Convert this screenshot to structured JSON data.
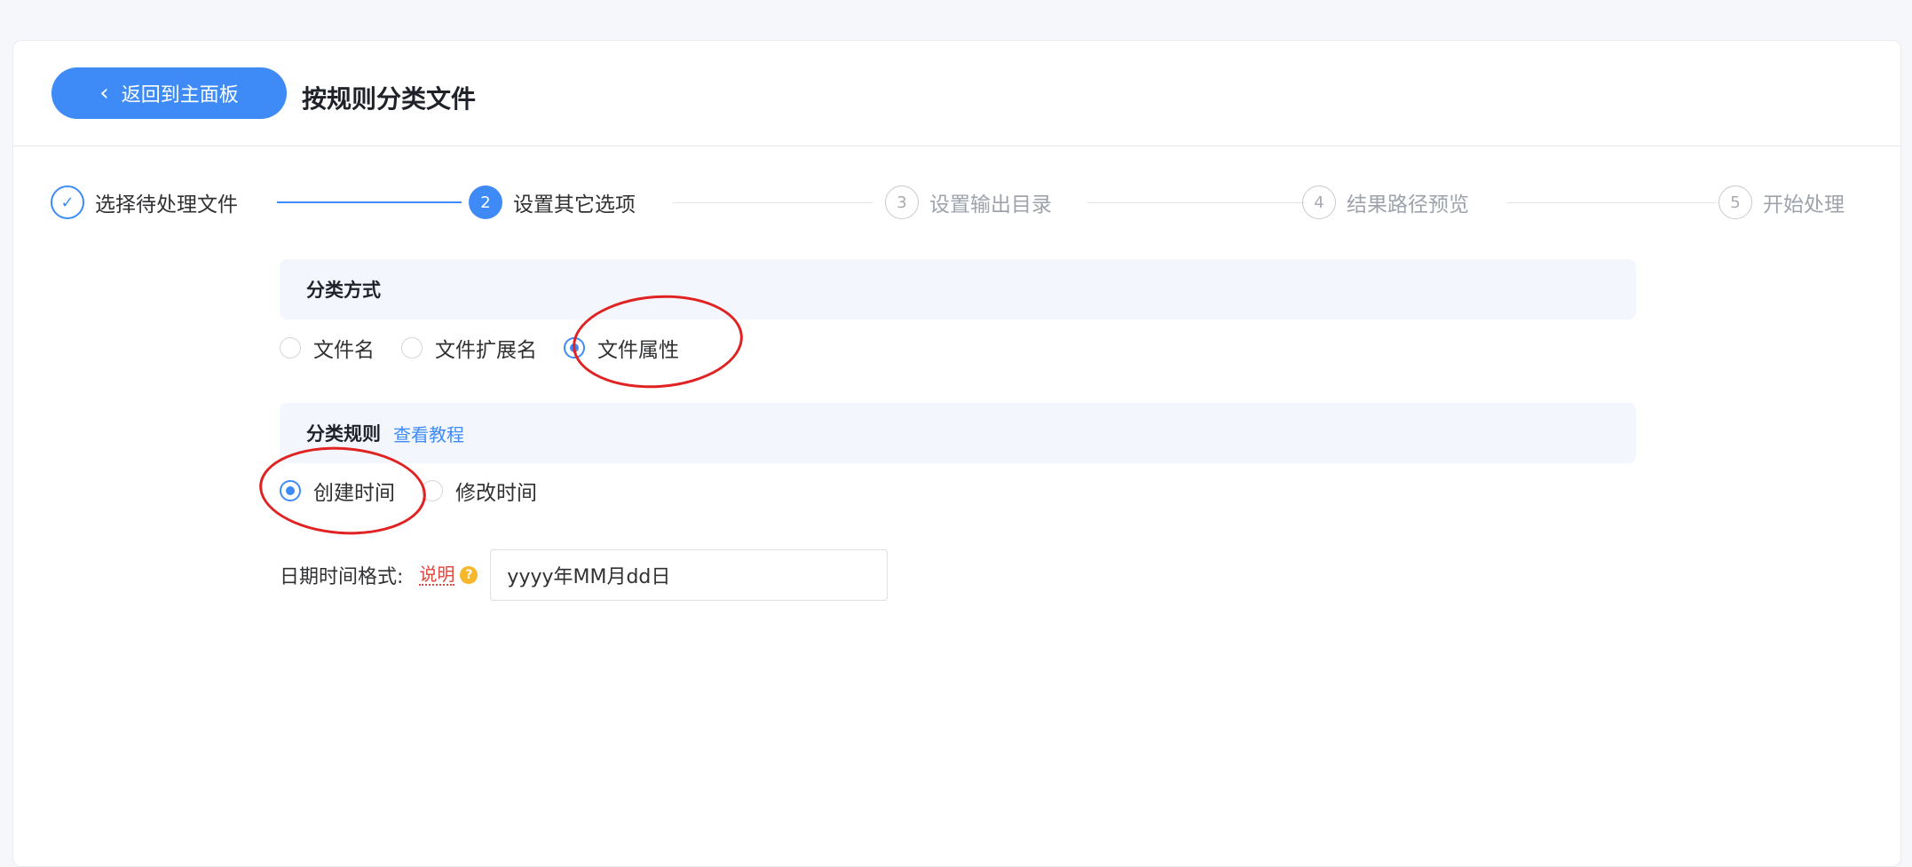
{
  "header": {
    "back_label": "返回到主面板",
    "title": "按规则分类文件"
  },
  "steps": [
    {
      "number": "✓",
      "label": "选择待处理文件",
      "state": "done"
    },
    {
      "number": "2",
      "label": "设置其它选项",
      "state": "active"
    },
    {
      "number": "3",
      "label": "设置输出目录",
      "state": "todo"
    },
    {
      "number": "4",
      "label": "结果路径预览",
      "state": "todo"
    },
    {
      "number": "5",
      "label": "开始处理",
      "state": "todo"
    }
  ],
  "classify_method": {
    "title": "分类方式",
    "options": [
      {
        "label": "文件名",
        "checked": false
      },
      {
        "label": "文件扩展名",
        "checked": false
      },
      {
        "label": "文件属性",
        "checked": true
      }
    ]
  },
  "classify_rule": {
    "title": "分类规则",
    "tutorial_link": "查看教程",
    "options": [
      {
        "label": "创建时间",
        "checked": true
      },
      {
        "label": "修改时间",
        "checked": false
      }
    ]
  },
  "date_format": {
    "label": "日期时间格式:",
    "help_link": "说明",
    "help_icon": "?",
    "value": "yyyy年MM月dd日"
  },
  "colors": {
    "accent": "#3e8bf7",
    "annotation": "#e02222"
  }
}
